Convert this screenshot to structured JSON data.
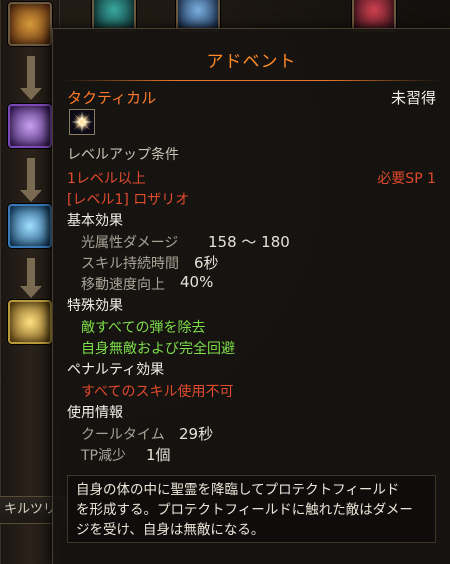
{
  "background": {
    "tree_label": "キルツリ"
  },
  "tooltip": {
    "title": "アドベント",
    "skill_type": "タクティカル",
    "learn_status": "未習得",
    "level_up_header": "レベルアップ条件",
    "req_level": "1レベル以上",
    "req_sp": "必要SP 1",
    "req_prereq": "[レベル1] ロザリオ",
    "basic_header": "基本効果",
    "basic": [
      {
        "label": "光属性ダメージ",
        "value": "158 ～ 180"
      },
      {
        "label": "スキル持続時間",
        "value": "6秒"
      },
      {
        "label": "移動速度向上",
        "value": "40%"
      }
    ],
    "special_header": "特殊効果",
    "special": [
      "敵すべての弾を除去",
      "自身無敵および完全回避"
    ],
    "penalty_header": "ペナルティ効果",
    "penalty": [
      "すべてのスキル使用不可"
    ],
    "usage_header": "使用情報",
    "usage": [
      {
        "label": "クールタイム",
        "value": "29秒"
      },
      {
        "label": "TP減少",
        "value": "1個"
      }
    ],
    "description": [
      "自身の体の中に聖霊を降臨してプロテクトフィールド",
      "を形成する。プロテクトフィールドに触れた敵はダメー",
      "ジを受け、自身は無敵になる。"
    ]
  },
  "colors": {
    "title": "#ff8a28",
    "requirement_unmet": "#e14a2c",
    "special": "#7ddc4a"
  }
}
